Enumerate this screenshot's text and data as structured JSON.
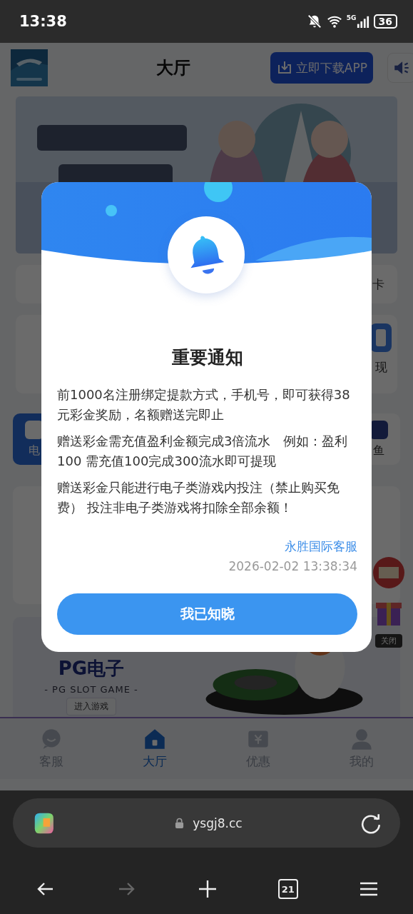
{
  "status_bar": {
    "time": "13:38",
    "network": "5G",
    "battery": "36"
  },
  "header": {
    "title": "大厅",
    "download_button": "立即下载APP"
  },
  "notice_bar": {
    "label": "卡"
  },
  "wallet_card": {
    "label": "现"
  },
  "game_tiles": [
    {
      "label": "电"
    },
    {
      "label": "鱼"
    }
  ],
  "pg_banner": {
    "logo_text": "PG电子",
    "subtitle": "- PG SLOT GAME -",
    "button": "进入游戏"
  },
  "float_close": "关闭",
  "nav": [
    {
      "label": "客服",
      "kind": "chat",
      "selected": false
    },
    {
      "label": "大厅",
      "kind": "home",
      "selected": true
    },
    {
      "label": "优惠",
      "kind": "coupon",
      "selected": false
    },
    {
      "label": "我的",
      "kind": "user",
      "selected": false
    }
  ],
  "dialog": {
    "title": "重要通知",
    "paragraphs": [
      "前1000名注册绑定提款方式，手机号，即可获得38元彩金奖励，名额赠送完即止",
      "赠送彩金需充值盈利金额完成3倍流水　例如：盈利100 需充值100完成300流水即可提现",
      "赠送彩金只能进行电子类游戏内投注（禁止购买免费） 投注非电子类游戏将扣除全部余额！"
    ],
    "signature": "永胜国际客服",
    "time": "2026-02-02 13:38:34",
    "button": "我已知晓"
  },
  "browser": {
    "url": "ysgj8.cc",
    "tab_count": "21",
    "forward_disabled": true
  }
}
